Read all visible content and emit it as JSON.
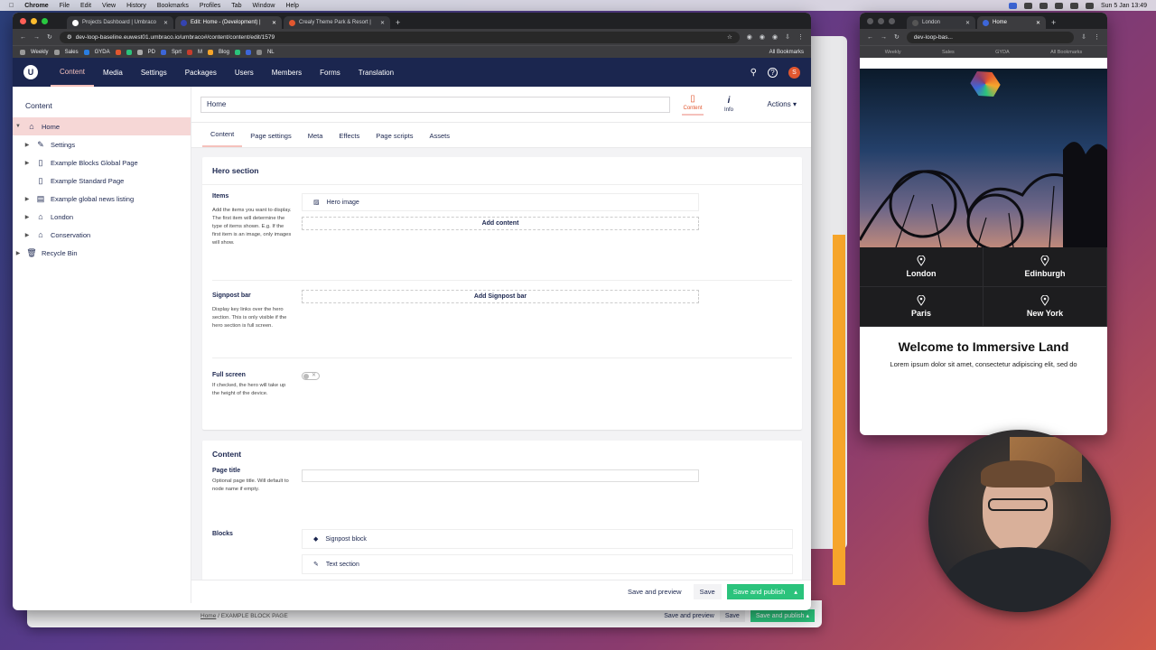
{
  "mac_menubar": {
    "app": "Chrome",
    "menus": [
      "File",
      "Edit",
      "View",
      "History",
      "Bookmarks",
      "Profiles",
      "Tab",
      "Window",
      "Help"
    ],
    "clock": "Sun 5 Jan 13:49"
  },
  "main_window": {
    "tabs": [
      {
        "title": "Projects Dashboard | Umbraco",
        "active": false
      },
      {
        "title": "Edit: Home - (Development) |",
        "active": true
      },
      {
        "title": "Crealy Theme Park & Resort |",
        "active": false
      }
    ],
    "url": "dev-loop-baseline.euwest01.umbraco.io/umbraco#/content/content/edit/1579",
    "bookmarks": [
      "Weekly",
      "Sales",
      "GYDA",
      "PD",
      "Sprt",
      "M",
      "Blog",
      "NL"
    ],
    "bookmarks_right": "All Bookmarks"
  },
  "umbraco": {
    "logo": "U",
    "nav": [
      "Content",
      "Media",
      "Settings",
      "Packages",
      "Users",
      "Members",
      "Forms",
      "Translation"
    ],
    "active_nav": "Content",
    "user_initial": "S",
    "tree": {
      "header": "Content",
      "items": [
        {
          "label": "Home",
          "icon": "home",
          "level": 0,
          "expanded": true,
          "selected": true
        },
        {
          "label": "Settings",
          "icon": "wrench",
          "level": 1,
          "expanded": false
        },
        {
          "label": "Example Blocks Global Page",
          "icon": "document",
          "level": 1,
          "expanded": false
        },
        {
          "label": "Example Standard Page",
          "icon": "document",
          "level": 1,
          "expanded": null
        },
        {
          "label": "Example global news listing",
          "icon": "newspaper",
          "level": 1,
          "expanded": false
        },
        {
          "label": "London",
          "icon": "home",
          "level": 1,
          "expanded": false
        },
        {
          "label": "Conservation",
          "icon": "home",
          "level": 1,
          "expanded": false
        },
        {
          "label": "Recycle Bin",
          "icon": "trash",
          "level": 0,
          "expanded": false
        }
      ]
    },
    "editor": {
      "node_name": "Home",
      "apps": [
        {
          "label": "Content",
          "active": true
        },
        {
          "label": "Info",
          "active": false
        }
      ],
      "actions_label": "Actions",
      "tabs": [
        "Content",
        "Page settings",
        "Meta",
        "Effects",
        "Page scripts",
        "Assets"
      ],
      "active_tab": "Content",
      "hero": {
        "title": "Hero section",
        "items_label": "Items",
        "items_desc": "Add the items you want to display. The first item will determine the type of items shown. E.g. If the first item is an image, only images will show.",
        "hero_image_block": "Hero image",
        "add_content": "Add content",
        "signpost_label": "Signpost bar",
        "signpost_desc": "Display key links over the hero section. This is only visible if the hero section is full screen.",
        "add_signpost": "Add Signpost bar",
        "fullscreen_label": "Full screen",
        "fullscreen_desc": "If checked, the hero will take up the height of the device.",
        "fullscreen_value": false
      },
      "content": {
        "title": "Content",
        "page_title_label": "Page title",
        "page_title_desc": "Optional page title. Will default to node name if empty.",
        "page_title_value": "",
        "blocks_label": "Blocks",
        "blocks": [
          "Signpost block",
          "Text section"
        ]
      },
      "footer": {
        "save_preview": "Save and preview",
        "save": "Save",
        "save_publish": "Save and publish"
      }
    }
  },
  "back_window": {
    "breadcrumb": [
      "Home",
      "EXAMPLE BLOCK PAGE"
    ],
    "save_preview": "Save and preview",
    "save": "Save",
    "save_publish": "Save and publish"
  },
  "side_window": {
    "tabs": [
      {
        "title": "London",
        "active": false
      },
      {
        "title": "Home",
        "active": true
      }
    ],
    "url": "dev-loop-bas...",
    "bookmarks": [
      "Weekly",
      "Sales",
      "GYDA"
    ],
    "bookmarks_right": "All Bookmarks",
    "cities": [
      "London",
      "Edinburgh",
      "Paris",
      "New York"
    ],
    "welcome_title": "Welcome to Immersive Land",
    "welcome_text": "Lorem ipsum dolor sit amet, consectetur adipiscing elit, sed do"
  },
  "colors": {
    "umbraco_navy": "#1b264f",
    "umbraco_pink": "#f5c1bc",
    "publish_green": "#2bc37c",
    "selected_tree": "#f6d7d6"
  }
}
